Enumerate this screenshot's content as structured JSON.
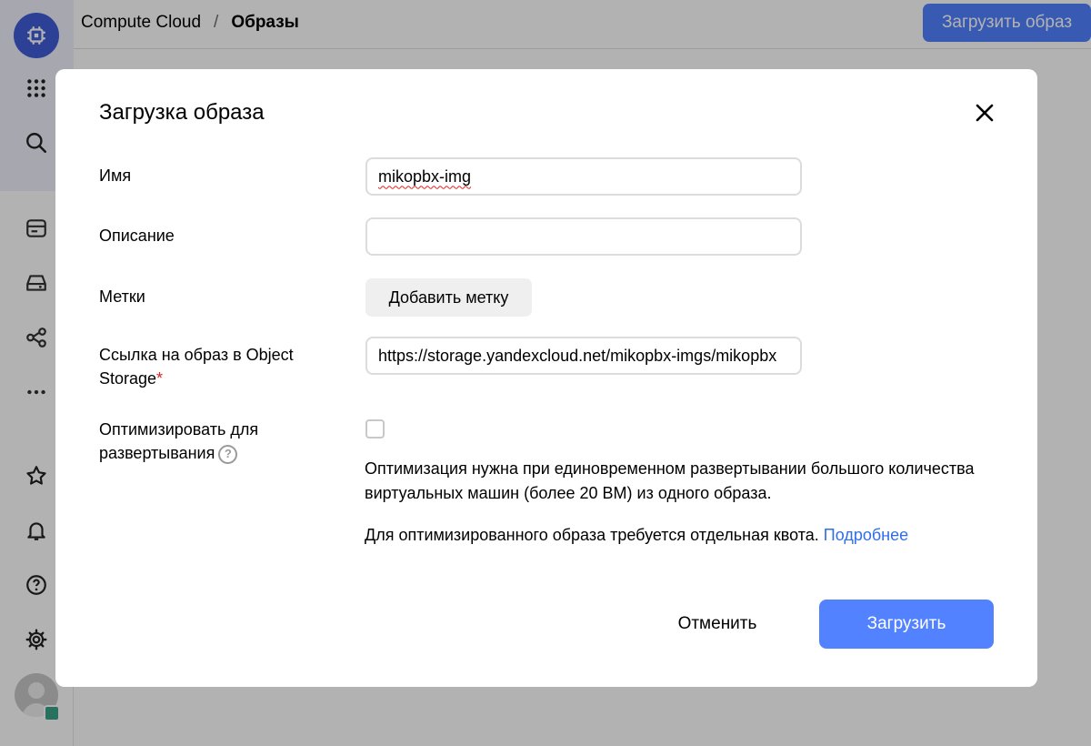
{
  "header": {
    "breadcrumb_service": "Compute Cloud",
    "breadcrumb_sep": "/",
    "breadcrumb_current": "Образы",
    "upload_button": "Загрузить образ"
  },
  "sidebar": {
    "icons": [
      "chip-icon",
      "apps-grid-icon",
      "search-icon",
      "card-icon",
      "disk-icon",
      "network-icon",
      "more-icon",
      "star-icon",
      "bell-icon",
      "help-icon",
      "gear-icon",
      "avatar"
    ]
  },
  "modal": {
    "title": "Загрузка образа",
    "fields": {
      "name_label": "Имя",
      "name_value": "mikopbx-img",
      "description_label": "Описание",
      "description_value": "",
      "labels_label": "Метки",
      "add_label_button": "Добавить метку",
      "url_label": "Ссылка на образ в Object Storage",
      "url_required_mark": "*",
      "url_value": "https://storage.yandexcloud.net/mikopbx-imgs/mikopbx",
      "optimize_label": "Оптимизировать для развертывания",
      "optimize_help": "?",
      "optimize_checked": false
    },
    "hint_1": "Оптимизация нужна при единовременном развертывании большого количества виртуальных машин (более 20 ВМ) из одного образа.",
    "hint_2": "Для оптимизированного образа требуется отдельная квота.",
    "hint_link": "Подробнее",
    "cancel_button": "Отменить",
    "submit_button": "Загрузить"
  },
  "colors": {
    "accent": "#5282ff",
    "link": "#2f6ee8",
    "required": "#e0221b"
  }
}
